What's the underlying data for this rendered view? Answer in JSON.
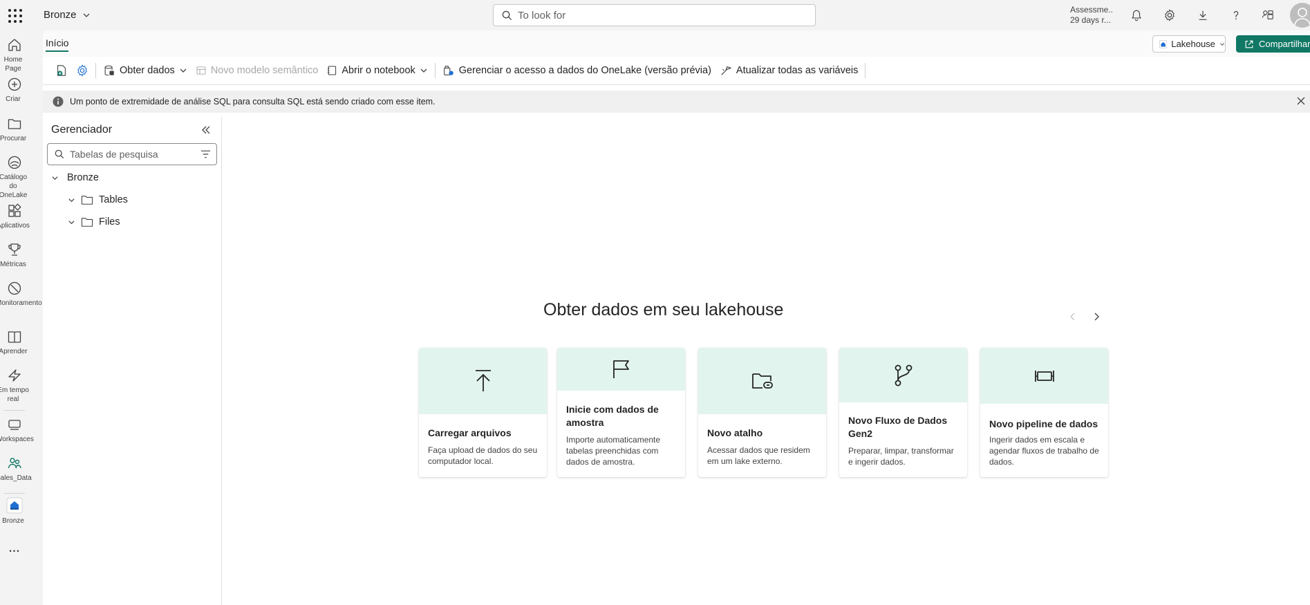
{
  "topbar": {
    "workspace": "Bronze",
    "search_placeholder": "To look for",
    "trial_line1": "Assessme...",
    "trial_line2": "29 days r..."
  },
  "rail": {
    "items": [
      {
        "label": "Home Page",
        "icon": "home-icon"
      },
      {
        "label": "Criar",
        "icon": "create-icon"
      },
      {
        "label": "Procurar",
        "icon": "folder-icon"
      },
      {
        "label": "Catálogo do OneLake",
        "icon": "onelake-icon"
      },
      {
        "label": "Aplicativos",
        "icon": "apps-icon"
      },
      {
        "label": "Métricas",
        "icon": "trophy-icon"
      },
      {
        "label": "Monitoramento",
        "icon": "monitor-icon"
      },
      {
        "label": "Aprender",
        "icon": "book-icon"
      },
      {
        "label": "Em tempo real",
        "icon": "lightning-icon"
      },
      {
        "label": "Workspaces",
        "icon": "workspaces-icon"
      },
      {
        "label": "Sales_Data",
        "icon": "people-icon"
      },
      {
        "label": "Bronze",
        "icon": "lakehouse-icon"
      }
    ],
    "more": "..."
  },
  "tabs": {
    "home": "Início",
    "lakehouse_dropdown": "Lakehouse",
    "share": "Compartilhar"
  },
  "ribbon": {
    "get_data": "Obter dados",
    "new_semantic_model": "Novo modelo semântico",
    "open_notebook": "Abrir o notebook",
    "manage_access": "Gerenciar o acesso a dados do OneLake (versão prévia)",
    "refresh_all": "Atualizar todas as variáveis"
  },
  "banner": {
    "message": "Um ponto de extremidade de análise SQL para consulta SQL está sendo criado com esse item."
  },
  "explorer": {
    "title": "Gerenciador",
    "search_placeholder": "Tabelas de pesquisa",
    "root": "Bronze",
    "children": [
      "Tables",
      "Files"
    ]
  },
  "main": {
    "title": "Obter dados em seu lakehouse",
    "cards": [
      {
        "title": "Carregar arquivos",
        "desc": "Faça upload de dados do seu computador local.",
        "icon": "upload-icon"
      },
      {
        "title": "Inicie com dados de amostra",
        "desc": "Importe automaticamente tabelas preenchidas com dados de amostra.",
        "icon": "flag-icon"
      },
      {
        "title": "Novo atalho",
        "desc": "Acessar dados que residem em um lake externo.",
        "icon": "shortcut-folder-icon"
      },
      {
        "title": "Novo Fluxo de Dados Gen2",
        "desc": "Preparar, limpar, transformar e ingerir dados.",
        "icon": "dataflow-icon"
      },
      {
        "title": "Novo pipeline de dados",
        "desc": "Ingerir dados em escala e agendar fluxos de trabalho de dados.",
        "icon": "pipeline-icon"
      }
    ]
  },
  "colors": {
    "accent": "#117865",
    "card_hero": "#e1f4ee"
  }
}
